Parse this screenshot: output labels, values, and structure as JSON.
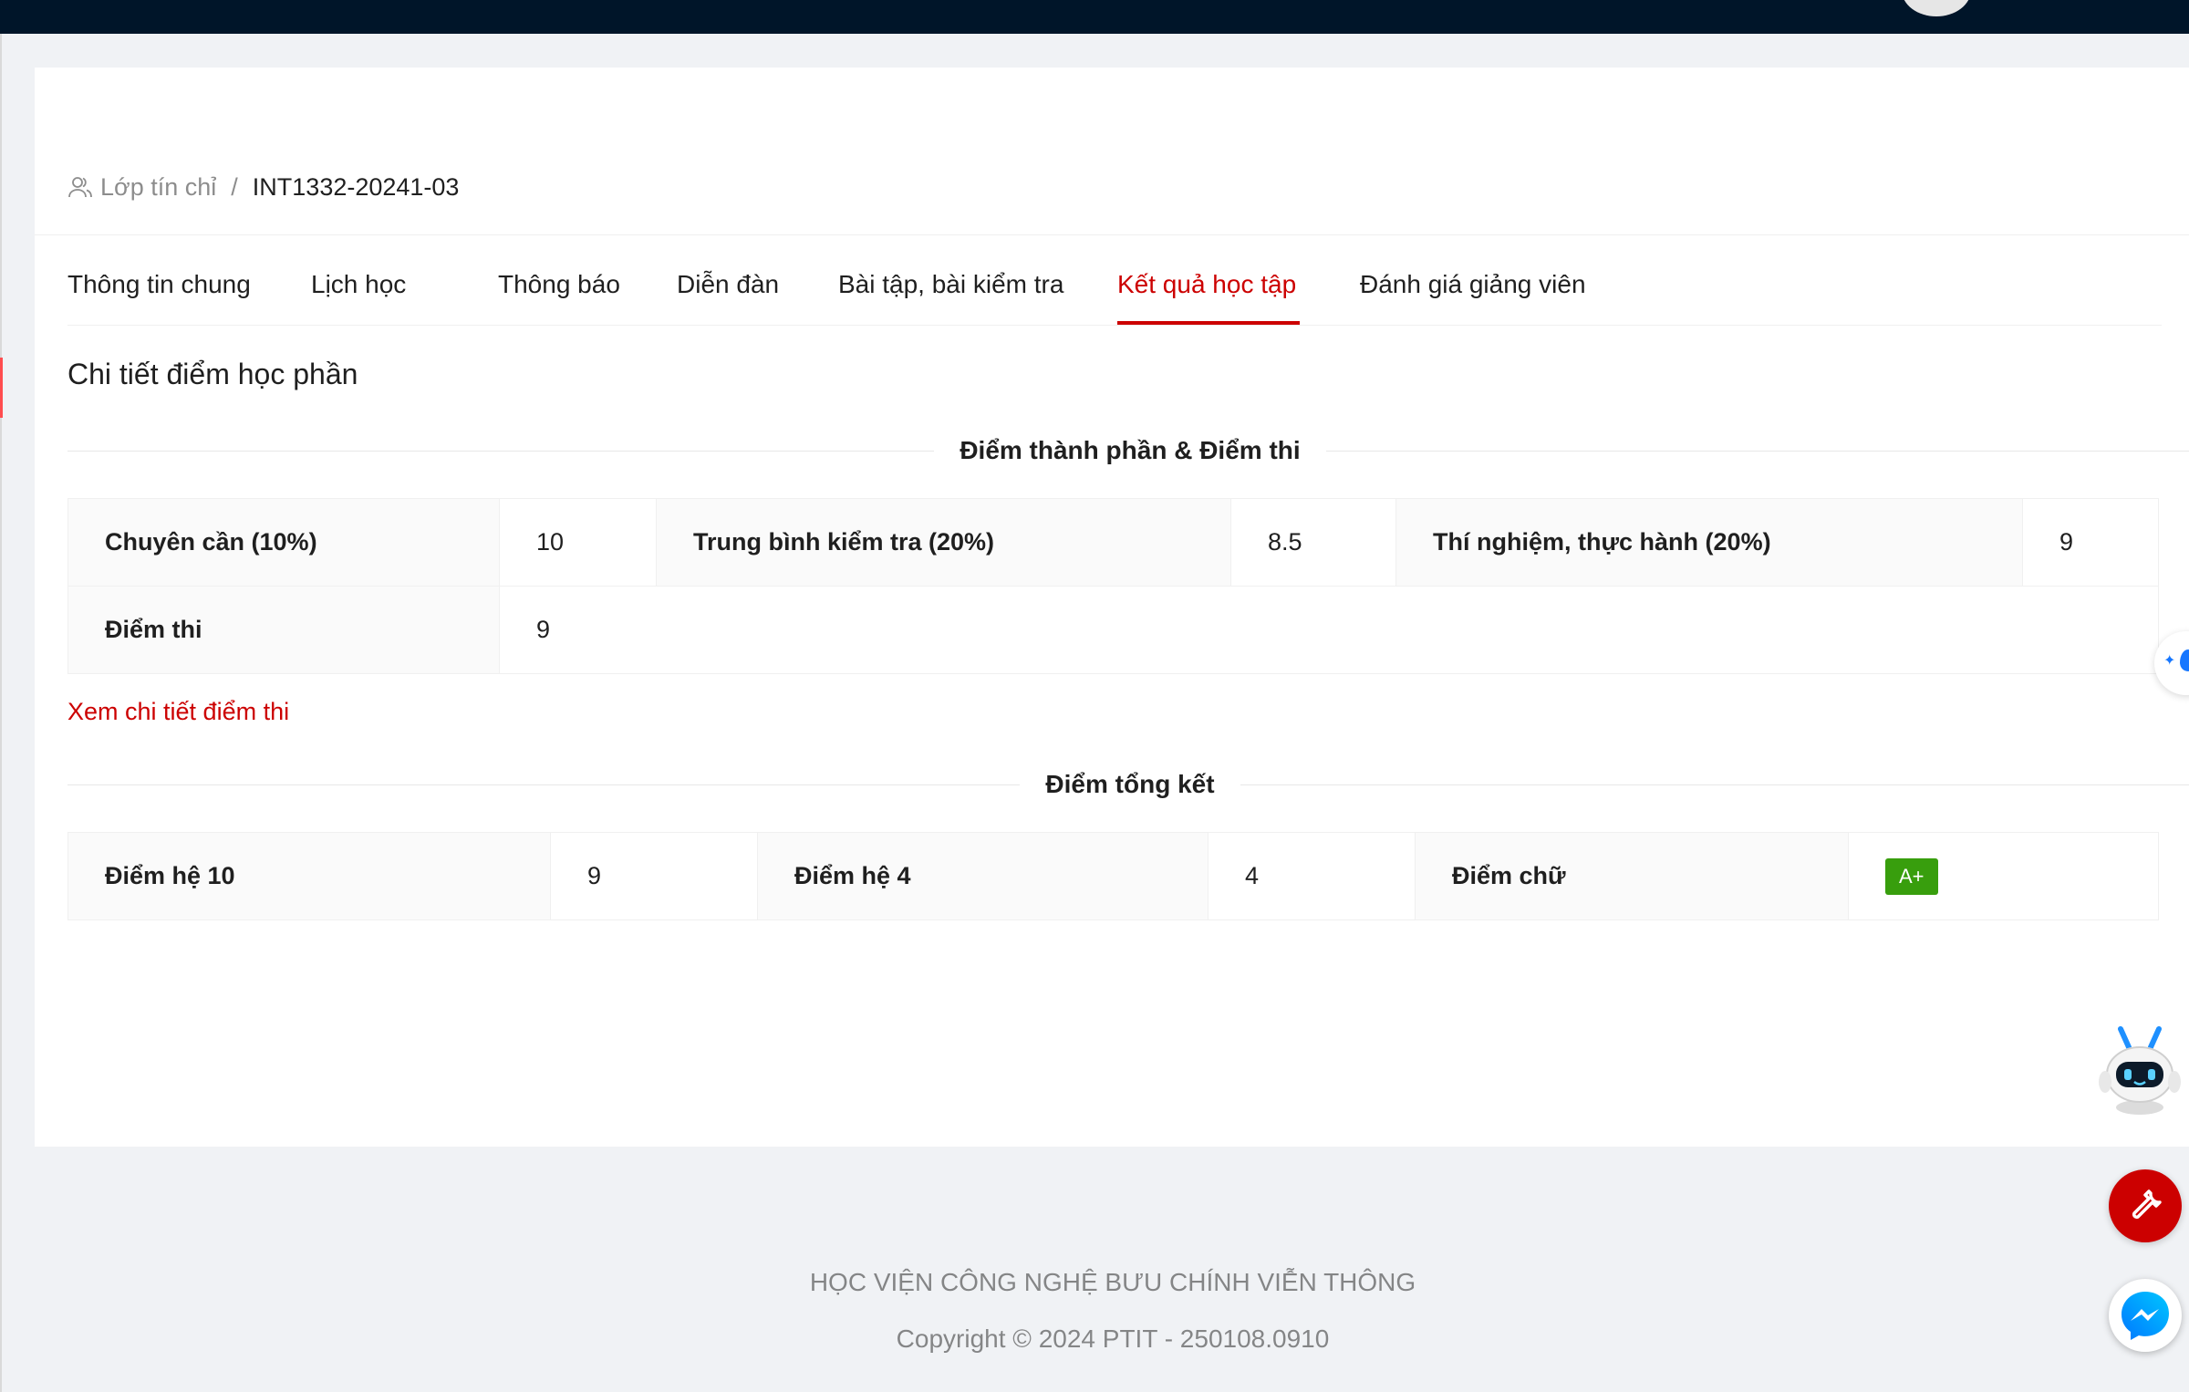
{
  "breadcrumb": {
    "icon": "user-group-icon",
    "parent": "Lớp tín chỉ",
    "separator": "/",
    "current": "INT1332-20241-03"
  },
  "tabs": [
    {
      "label": "Thông tin chung",
      "active": false
    },
    {
      "label": "Lịch học",
      "active": false
    },
    {
      "label": "Thông báo",
      "active": false
    },
    {
      "label": "Diễn đàn",
      "active": false
    },
    {
      "label": "Bài tập, bài kiểm tra",
      "active": false
    },
    {
      "label": "Kết quả học tập",
      "active": true
    },
    {
      "label": "Đánh giá giảng viên",
      "active": false
    }
  ],
  "section_title": "Chi tiết điểm học phần",
  "component_scores": {
    "heading": "Điểm thành phần & Điểm thi",
    "rows": [
      [
        {
          "label": "Chuyên cần (10%)",
          "value": "10"
        },
        {
          "label": "Trung bình kiểm tra (20%)",
          "value": "8.5"
        },
        {
          "label": "Thí nghiệm, thực hành (20%)",
          "value": "9"
        }
      ],
      [
        {
          "label": "Điểm thi",
          "value": "9"
        }
      ]
    ],
    "detail_link": "Xem chi tiết điểm thi"
  },
  "final_scores": {
    "heading": "Điểm tổng kết",
    "items": [
      {
        "label": "Điểm hệ 10",
        "value": "9"
      },
      {
        "label": "Điểm hệ 4",
        "value": "4"
      },
      {
        "label": "Điểm chữ",
        "value": "A+"
      }
    ]
  },
  "footer": {
    "org": "HỌC VIỆN CÔNG NGHỆ BƯU CHÍNH VIỄN THÔNG",
    "copyright": "Copyright © 2024 PTIT - 250108.0910"
  },
  "colors": {
    "accent": "#cc0000",
    "header_bg": "#001529",
    "grade_tag": "#389e0d"
  },
  "floating_buttons": [
    "water-drop-icon",
    "robot-assistant-icon",
    "wrench-icon",
    "messenger-icon"
  ]
}
